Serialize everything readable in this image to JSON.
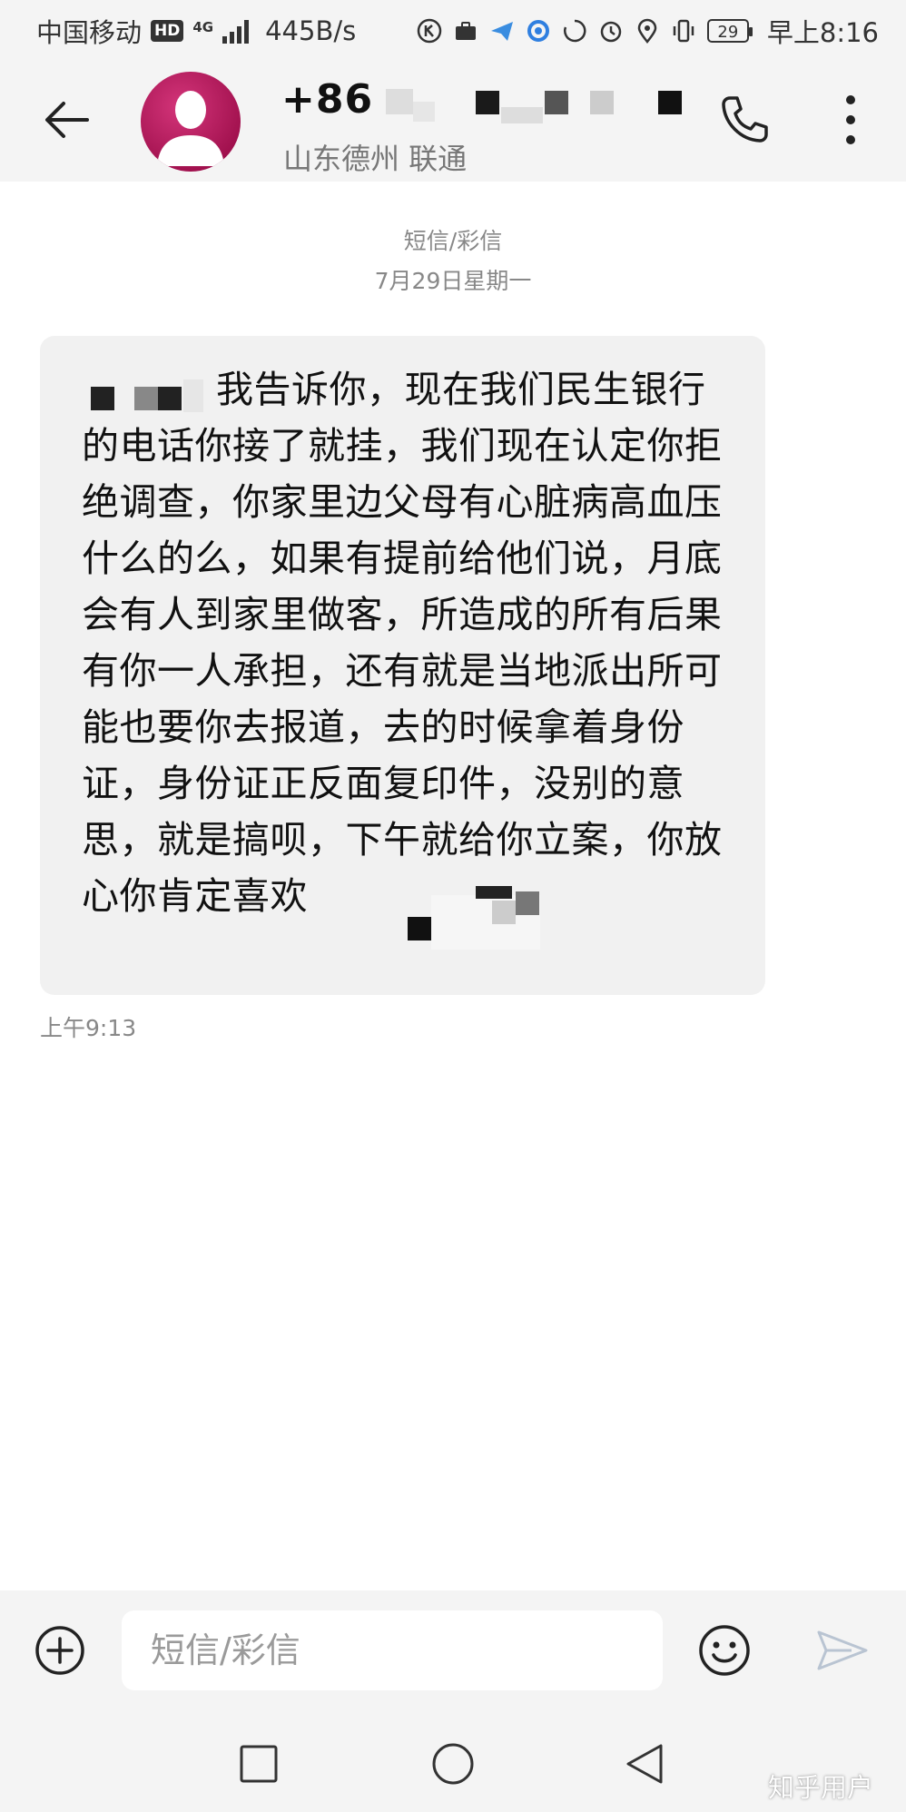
{
  "status_bar": {
    "carrier": "中国移动",
    "hd": "HD",
    "network": "4G",
    "speed": "445B/s",
    "battery": "29",
    "time": "早上8:16"
  },
  "header": {
    "number_prefix": "+86",
    "location": "山东德州 联通",
    "back_icon": "arrow-left-icon",
    "call_icon": "phone-icon",
    "more_icon": "more-vertical-icon"
  },
  "conversation": {
    "message_type": "短信/彩信",
    "date": "7月29日星期一",
    "messages": [
      {
        "text": "我告诉你，现在我们民生银行的电话你接了就挂，我们现在认定你拒绝调查，你家里边父母有心脏病高血压什么的么，如果有提前给他们说，月底会有人到家里做客，所造成的所有后果有你一人承担，还有就是当地派出所可能也要你去报道，去的时候拿着身份证，身份证正反面复印件，没别的意思，就是搞呗，下午就给你立案，你放心你肯定喜欢",
        "time": "上午9:13"
      }
    ]
  },
  "input_bar": {
    "placeholder": "短信/彩信",
    "add_icon": "plus-circle-icon",
    "emoji_icon": "smiley-icon",
    "send_icon": "send-icon"
  },
  "nav_bar": {
    "recent_icon": "square-icon",
    "home_icon": "circle-icon",
    "back_icon": "triangle-back-icon"
  },
  "watermark": "知乎用户",
  "colors": {
    "bar_background": "#f4f4f4",
    "bubble_background": "#f1f1f1",
    "avatar": "#b8155d",
    "muted_text": "#888888"
  }
}
